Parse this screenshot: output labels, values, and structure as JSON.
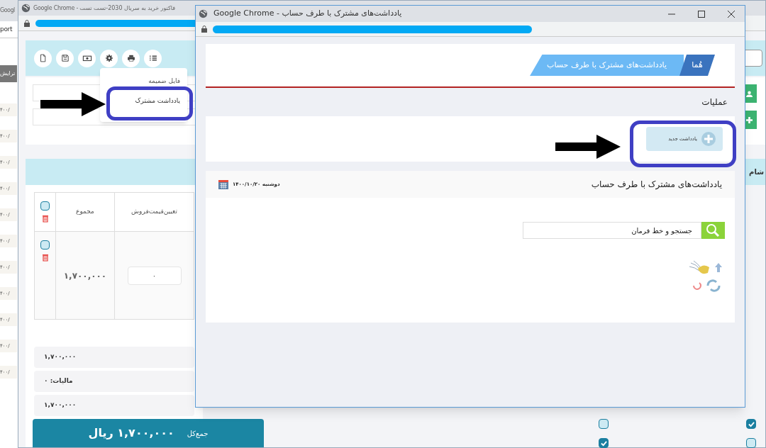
{
  "background_window": {
    "title": "Googl",
    "address": "port",
    "side_label": "ترایش",
    "rows": [
      "۴۰۰/",
      "۴۰۰/",
      "۴۰۰/",
      "۴۰۰/",
      "۴۰۰/",
      "۴۰۰/",
      "۴۰۰/",
      "۴۰۰/",
      "۴۰۰/",
      "۴۰۰/",
      "۴۰۰/"
    ]
  },
  "invoice_window": {
    "title": "Google Chrome - فاکتور خرید به سریال 2030-تست تست",
    "menu": [
      {
        "label": "فایل ضمیمه",
        "selected": false
      },
      {
        "label": "یادداشت مشترک",
        "selected": true
      }
    ],
    "table": {
      "columns": [
        "تعیین‌قیمت‌فروش",
        "مجموع"
      ],
      "select_all_checked": false,
      "rows": [
        {
          "checked": false,
          "total": "۱,۷۰۰,۰۰۰",
          "price_value": "۰"
        }
      ]
    },
    "summary": [
      {
        "text": "۱,۷۰۰,۰۰۰"
      },
      {
        "text": "مالیات: ۰"
      },
      {
        "text": "۱,۷۰۰,۰۰۰"
      }
    ],
    "grand_total": {
      "label": "جمع‌کل",
      "value": "۱,۷۰۰,۰۰۰ ریال"
    },
    "side_band": "شام",
    "options": [
      {
        "checked": true
      },
      {
        "checked": false
      },
      {
        "checked": false
      },
      {
        "checked": true
      }
    ]
  },
  "notes_window": {
    "title": "Google Chrome - یادداشت‌های مشترک با طرف حساب",
    "breadcrumb": [
      "هُما",
      "یادداشت‌های مشترک با طرف حساب"
    ],
    "operations_title": "عملیات",
    "new_note_button": "یادداشت جدید",
    "notes_card": {
      "title": "یادداشت‌های مشترک با طرف حساب",
      "date": "دوشنبه ۱۴۰۰/۱۰/۲۰",
      "search": {
        "value": "جستجو و خط فرمان"
      }
    }
  }
}
